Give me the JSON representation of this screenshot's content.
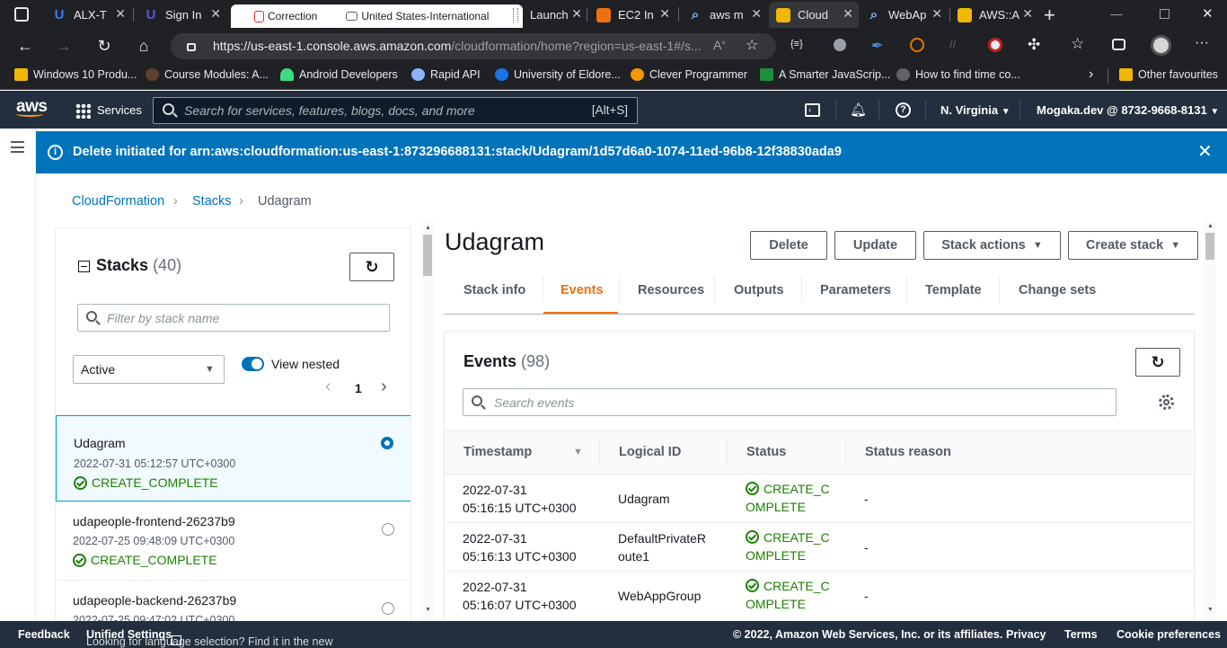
{
  "browser": {
    "tabs": [
      {
        "label": "ALX-T",
        "favicon_color": "#2d7ff9",
        "active": false
      },
      {
        "label": "Sign In",
        "favicon_color": "#5b5bd6",
        "active": false
      },
      {
        "label": "Correction",
        "favicon_color": "#d93025",
        "active": true
      },
      {
        "label": "United States-International",
        "favicon_color": "#9aa0a6",
        "active": true
      },
      {
        "label": "Launch",
        "favicon_color": "#ff9900",
        "active": false
      },
      {
        "label": "EC2 In",
        "favicon_color": "#ec7211",
        "active": false
      },
      {
        "label": "aws m",
        "favicon_color": "#8ab4f8",
        "active": false
      },
      {
        "label": "Cloud",
        "favicon_color": "#f2b705",
        "active": false
      },
      {
        "label": "WebAp",
        "favicon_color": "#8ab4f8",
        "active": false
      },
      {
        "label": "AWS::A",
        "favicon_color": "#f2b705",
        "active": false
      }
    ],
    "url_host": "https://us-east-1.console.aws.amazon.com",
    "url_path": "/cloudformation/home?region=us-east-1#/s...",
    "bookmarks": [
      {
        "label": "Windows 10 Produ...",
        "color": "#f2b705"
      },
      {
        "label": "Course Modules: A...",
        "color": "#5f3f2f"
      },
      {
        "label": "Android Developers",
        "color": "#3ddc84"
      },
      {
        "label": "Rapid API",
        "color": "#8ab4f8"
      },
      {
        "label": "University of Eldore...",
        "color": "#1a73e8"
      },
      {
        "label": "Clever Programmer",
        "color": "#f29900"
      },
      {
        "label": "A Smarter JavaScrip...",
        "color": "#1e8e3e"
      },
      {
        "label": "How to find time co...",
        "color": "#5f6368"
      },
      {
        "label": "Other favourites",
        "color": "#f2b705"
      }
    ]
  },
  "aws_nav": {
    "logo": "aws",
    "services_label": "Services",
    "search_placeholder": "Search for services, features, blogs, docs, and more",
    "search_shortcut": "[Alt+S]",
    "region": "N. Virginia",
    "account": "Mogaka.dev @ 8732-9668-8131"
  },
  "flash": {
    "message": "Delete initiated for arn:aws:cloudformation:us-east-1:873296688131:stack/Udagram/1d57d6a0-1074-11ed-96b8-12f38830ada9"
  },
  "breadcrumb": [
    "CloudFormation",
    "Stacks",
    "Udagram"
  ],
  "stacks_panel": {
    "title": "Stacks",
    "count": "(40)",
    "filter_placeholder": "Filter by stack name",
    "status_filter": "Active",
    "view_nested_label": "View nested",
    "page": "1",
    "items": [
      {
        "name": "Udagram",
        "date": "2022-07-31 05:12:57 UTC+0300",
        "status": "CREATE_COMPLETE",
        "selected": true
      },
      {
        "name": "udapeople-frontend-26237b9",
        "date": "2022-07-25 09:48:09 UTC+0300",
        "status": "CREATE_COMPLETE",
        "selected": false
      },
      {
        "name": "udapeople-backend-26237b9",
        "date": "2022-07-25 09:47:02 UTC+0300",
        "status": "",
        "selected": false
      }
    ]
  },
  "detail": {
    "title": "Udagram",
    "buttons": {
      "delete": "Delete",
      "update": "Update",
      "stack_actions": "Stack actions",
      "create_stack": "Create stack"
    },
    "tabs": [
      "Stack info",
      "Events",
      "Resources",
      "Outputs",
      "Parameters",
      "Template",
      "Change sets"
    ],
    "active_tab": "Events"
  },
  "events": {
    "title": "Events",
    "count": "(98)",
    "search_placeholder": "Search events",
    "columns": [
      "Timestamp",
      "Logical ID",
      "Status",
      "Status reason"
    ],
    "rows": [
      {
        "ts1": "2022-07-31",
        "ts2": "05:16:15 UTC+0300",
        "id1": "Udagram",
        "id2": "",
        "st1": "CREATE_C",
        "st2": "OMPLETE",
        "reason": "-"
      },
      {
        "ts1": "2022-07-31",
        "ts2": "05:16:13 UTC+0300",
        "id1": "DefaultPrivateR",
        "id2": "oute1",
        "st1": "CREATE_C",
        "st2": "OMPLETE",
        "reason": "-"
      },
      {
        "ts1": "2022-07-31",
        "ts2": "05:16:07 UTC+0300",
        "id1": "WebAppGroup",
        "id2": "",
        "st1": "CREATE_C",
        "st2": "OMPLETE",
        "reason": "-"
      }
    ]
  },
  "footer": {
    "feedback": "Feedback",
    "language_note": "Looking for language selection? Find it in the new",
    "unified": "Unified Settings",
    "copyright": "© 2022, Amazon Web Services, Inc. or its affiliates.",
    "privacy": "Privacy",
    "terms": "Terms",
    "cookies": "Cookie preferences"
  }
}
